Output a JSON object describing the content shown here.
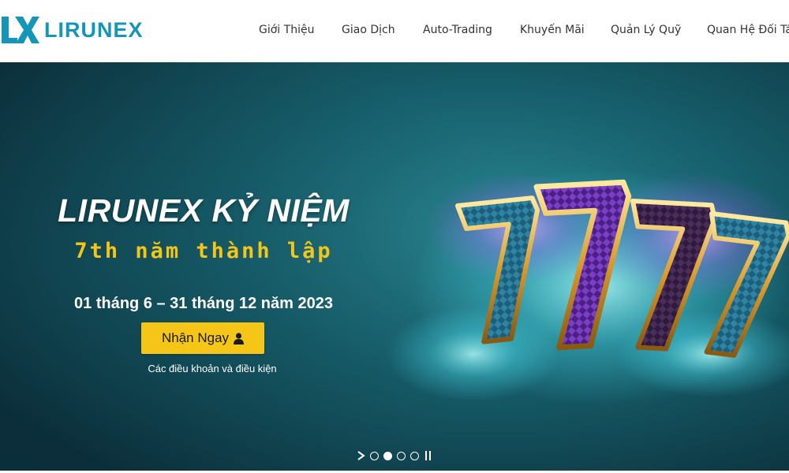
{
  "brand": {
    "name": "LIRUNEX",
    "logo_mark_text": "LX",
    "color": "#1596b9"
  },
  "nav": {
    "items": [
      {
        "label": "Giới Thiệu"
      },
      {
        "label": "Giao Dịch"
      },
      {
        "label": "Auto-Trading"
      },
      {
        "label": "Khuyến Mãi"
      },
      {
        "label": "Quản Lý Quỹ"
      },
      {
        "label": "Quan Hệ Đối Tác"
      }
    ]
  },
  "hero": {
    "headline": "LIRUNEX KỶ NIỆM",
    "subheadline": "7th năm thành lập",
    "date_range": "01 tháng 6 – 31 tháng 12 năm 2023",
    "cta_label": "Nhận Ngay",
    "cta_icon": "user-icon",
    "terms_link": "Các điều khoản và điều kiện",
    "art_text": "7777",
    "colors": {
      "accent_yellow": "#f5c518",
      "bg_dark": "#0e2f3a",
      "bg_teal": "#1d6b77"
    }
  },
  "carousel": {
    "slide_count": 4,
    "active_slide": 2,
    "next_icon": "chevron-right-icon",
    "pause_icon": "pause-icon"
  }
}
